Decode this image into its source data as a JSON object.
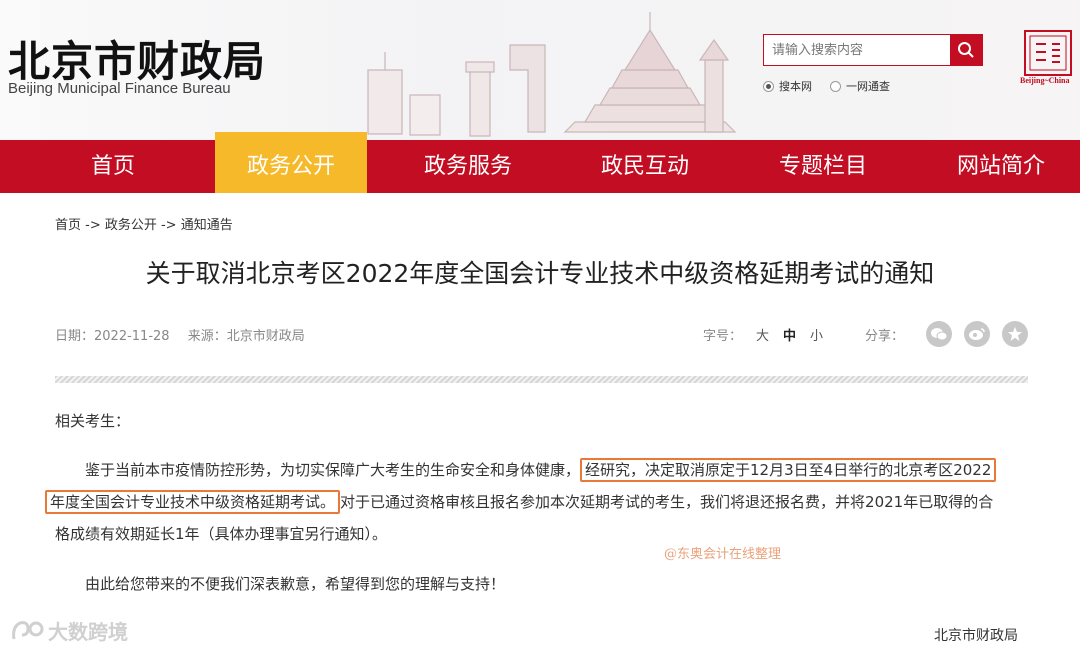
{
  "header": {
    "logo_cn": "北京市财政局",
    "logo_en": "Beijing Municipal Finance Bureau",
    "search": {
      "placeholder": "请输入搜索内容",
      "options": [
        {
          "label": "搜本网",
          "selected": true
        },
        {
          "label": "一网通查",
          "selected": false
        }
      ]
    },
    "seal_en": "Beijing~China"
  },
  "nav": {
    "items": [
      {
        "label": "首页",
        "active": false
      },
      {
        "label": "政务公开",
        "active": true
      },
      {
        "label": "政务服务",
        "active": false
      },
      {
        "label": "政民互动",
        "active": false
      },
      {
        "label": "专题栏目",
        "active": false
      },
      {
        "label": "网站简介",
        "active": false
      }
    ]
  },
  "breadcrumb": "首页 -> 政务公开 -> 通知通告",
  "article": {
    "title": "关于取消北京考区2022年度全国会计专业技术中级资格延期考试的通知",
    "date": "日期：2022-11-28",
    "source": "来源：北京市财政局",
    "font_label": "字号：",
    "font_sizes": [
      "大",
      "中",
      "小"
    ],
    "share_label": "分享：",
    "greeting": "相关考生：",
    "p1_a": "鉴于当前本市疫情防控形势，为切实保障广大考生的生命安全和身体健康，",
    "p1_hl1": "经研究，决定取消原定于12月3日至4日举行的北京考区2022",
    "p1_hl2": "年度全国会计专业技术中级资格延期考试。",
    "p1_b": "对于已通过资格审核且报名参加本次延期考试的考生，我们将退还报名费，并将2021年已取得的合",
    "p1_c": "格成绩有效期延长1年（具体办理事宜另行通知）。",
    "p2": "由此给您带来的不便我们深表歉意，希望得到您的理解与支持！",
    "signature": "北京市财政局"
  },
  "watermarks": {
    "dongao": "@东奥会计在线整理",
    "bottom_left": "大数跨境"
  },
  "colors": {
    "brand_red": "#c30d23",
    "nav_active": "#f6b92a",
    "highlight_border": "#e9783b"
  }
}
